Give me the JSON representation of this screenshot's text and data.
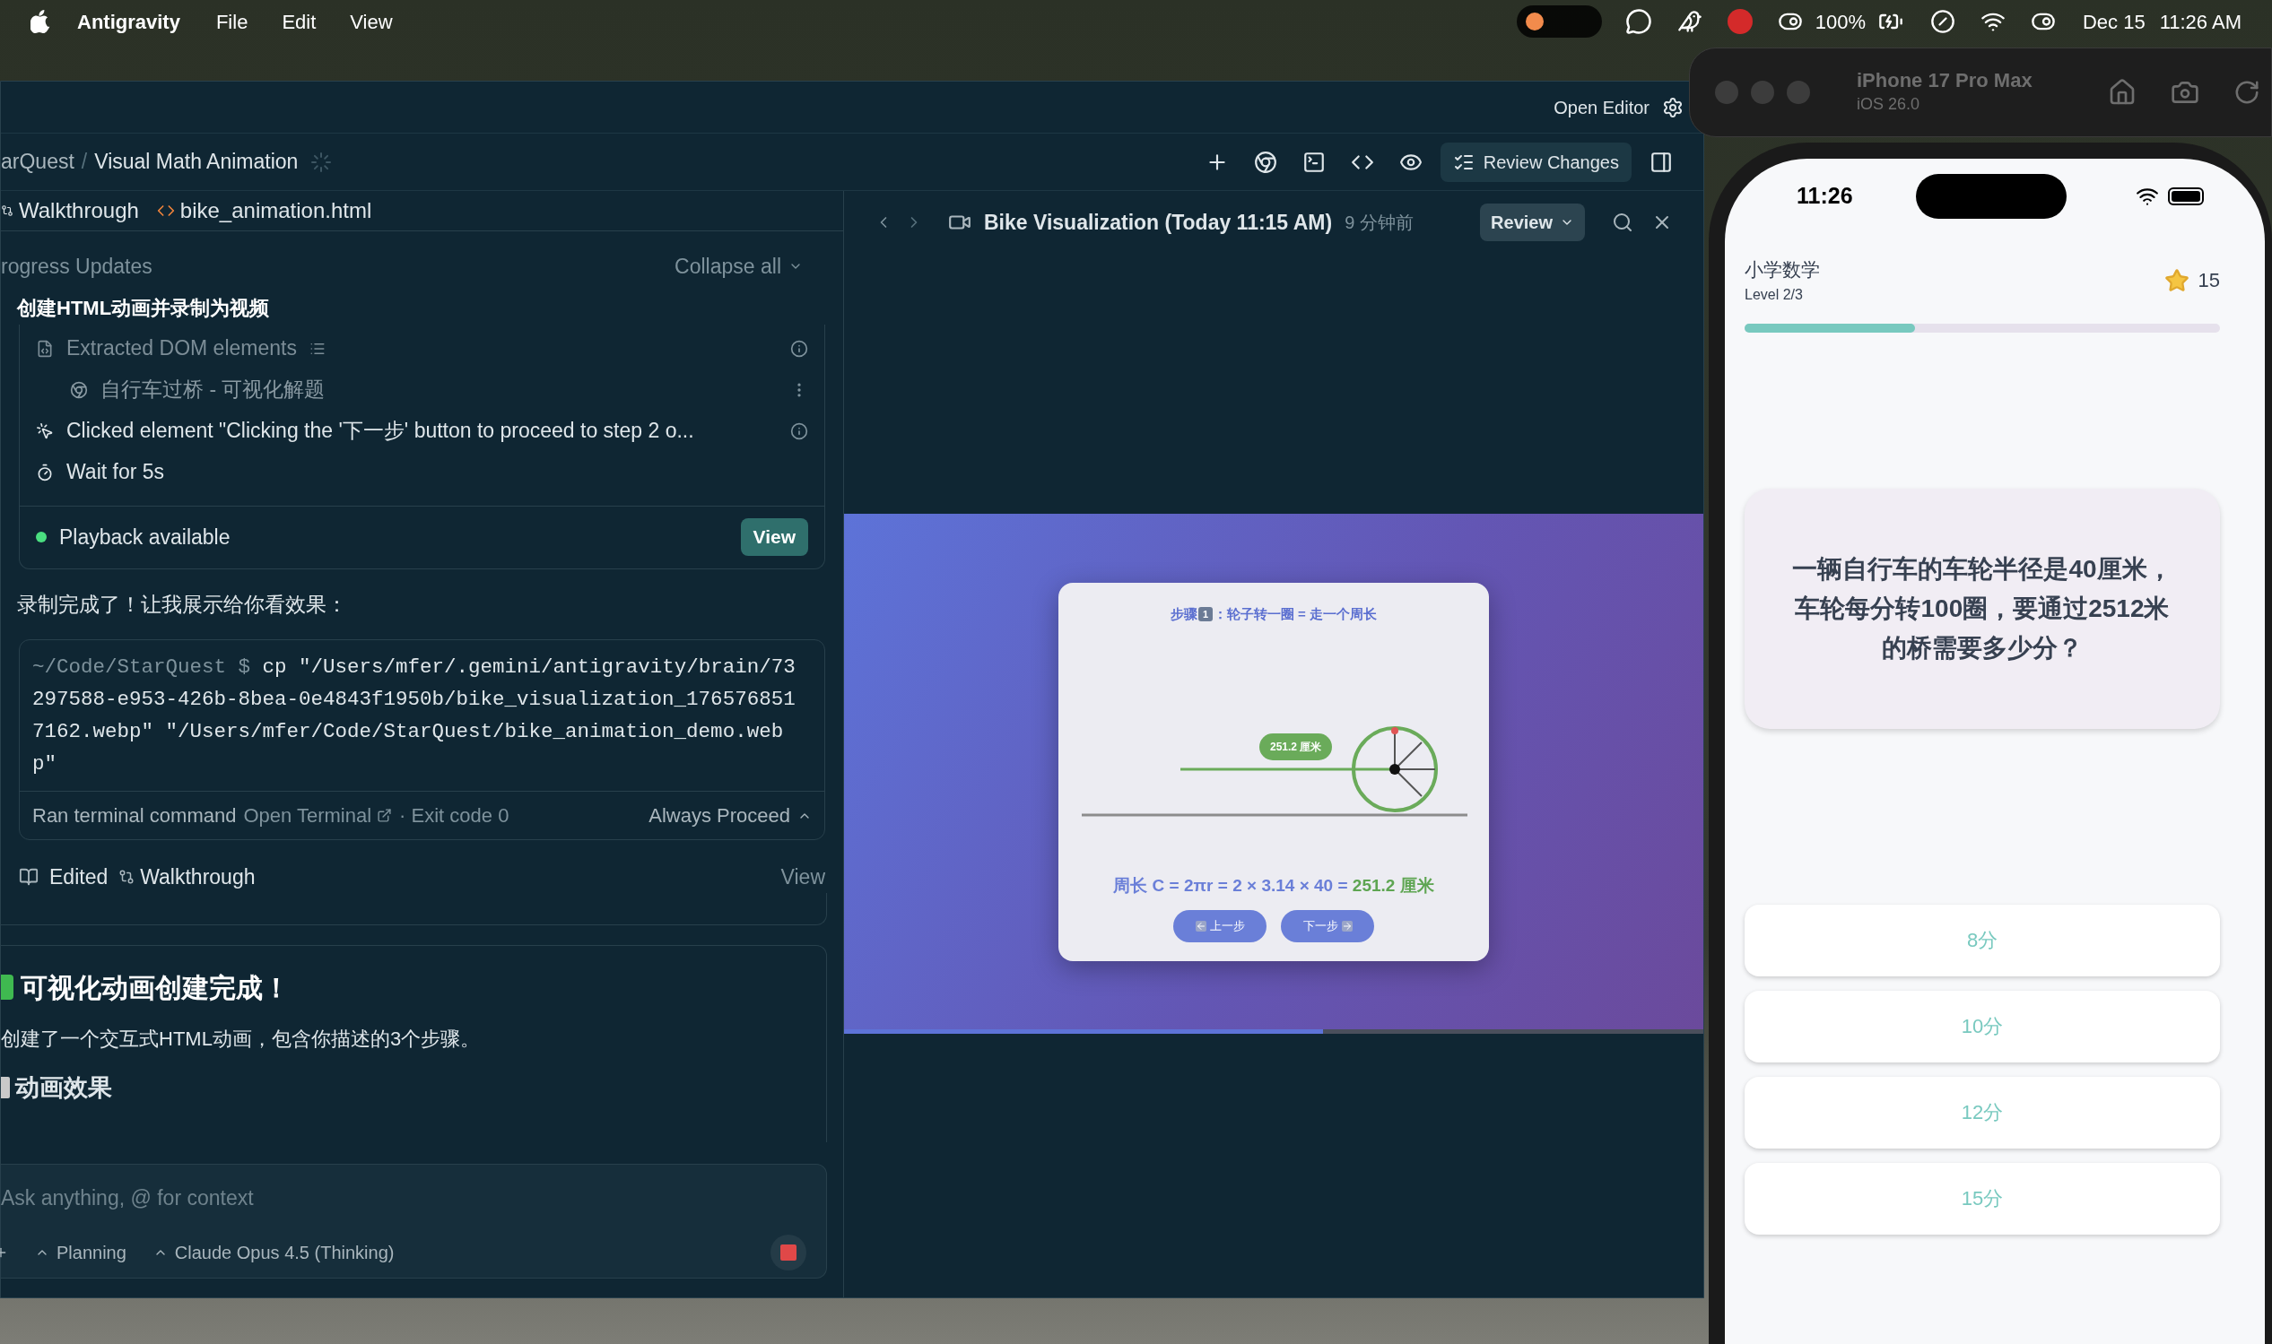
{
  "menu_bar": {
    "app_name": "Antigravity",
    "menus": [
      "File",
      "Edit",
      "View"
    ],
    "battery": "100%",
    "date": "Dec 15",
    "time": "11:26 AM"
  },
  "ide": {
    "open_editor": "Open Editor",
    "breadcrumb": [
      "arQuest",
      "Visual Math Animation"
    ],
    "breadcrumb_separator": "/",
    "review_changes": "Review Changes",
    "file_tabs": [
      {
        "kind": "doc",
        "label": "Walkthrough"
      },
      {
        "kind": "code",
        "label": "bike_animation.html"
      }
    ],
    "progress": {
      "title": "rogress Updates",
      "collapse": "Collapse all",
      "task_title": "创建HTML动画并录制为视频",
      "steps": [
        {
          "kind": "dom",
          "text": "Extracted DOM elements"
        },
        {
          "kind": "page",
          "text": "自行车过桥 - 可视化解题"
        },
        {
          "kind": "click",
          "text": "Clicked element \"Clicking the '下一步' button to proceed to step 2 o..."
        },
        {
          "kind": "wait",
          "text": "Wait for 5s"
        }
      ],
      "playback": {
        "text": "Playback available",
        "button": "View"
      }
    },
    "message": "录制完成了！让我展示给你看效果：",
    "terminal": {
      "cwd": "~/Code/StarQuest $",
      "command": "cp \"/Users/mfer/.gemini/antigravity/brain/73297588-e953-426b-8bea-0e4843f1950b/bike_visualization_1765768517162.webp\" \"/Users/mfer/Code/StarQuest/bike_animation_demo.webp\"",
      "status": "Ran terminal command",
      "open_terminal": "Open Terminal",
      "exit": "· Exit code 0",
      "always": "Always Proceed"
    },
    "edited": {
      "label": "Edited",
      "file": "Walkthrough",
      "view": "View"
    },
    "summary": {
      "heading": "可视化动画创建完成！",
      "body": "创建了一个交互式HTML动画，包含你描述的3个步骤。",
      "subheading": "动画效果"
    },
    "composer": {
      "placeholder": "Ask anything, @ for context",
      "mode": "Planning",
      "model": "Claude Opus 4.5 (Thinking)"
    },
    "preview": {
      "title": "Bike Visualization (Today 11:15 AM)",
      "ago": "9 分钟前",
      "review": "Review",
      "video": {
        "level": 0.557,
        "step_label": "步骤",
        "step_number": "1",
        "step_text": "：轮子转一圈 = 走一个周长",
        "distance": "251.2 厘米",
        "formula": "周长 C = 2πr = 2 × 3.14 × 40 = ",
        "result": "251.2 厘米",
        "prev": "上一步",
        "next": "下一步"
      }
    }
  },
  "simulator": {
    "device": "iPhone 17 Pro Max",
    "os": "iOS 26.0",
    "phone": {
      "time": "11:26",
      "title": "小学数学",
      "level_text": "Level 2/3",
      "star_count": "15",
      "progress": {
        "level": 0.358
      },
      "question": "一辆自行车的车轮半径是40厘米，车轮每分转100圈，要通过2512米的桥需要多少分？",
      "options": [
        "8分",
        "10分",
        "12分",
        "15分"
      ]
    }
  }
}
